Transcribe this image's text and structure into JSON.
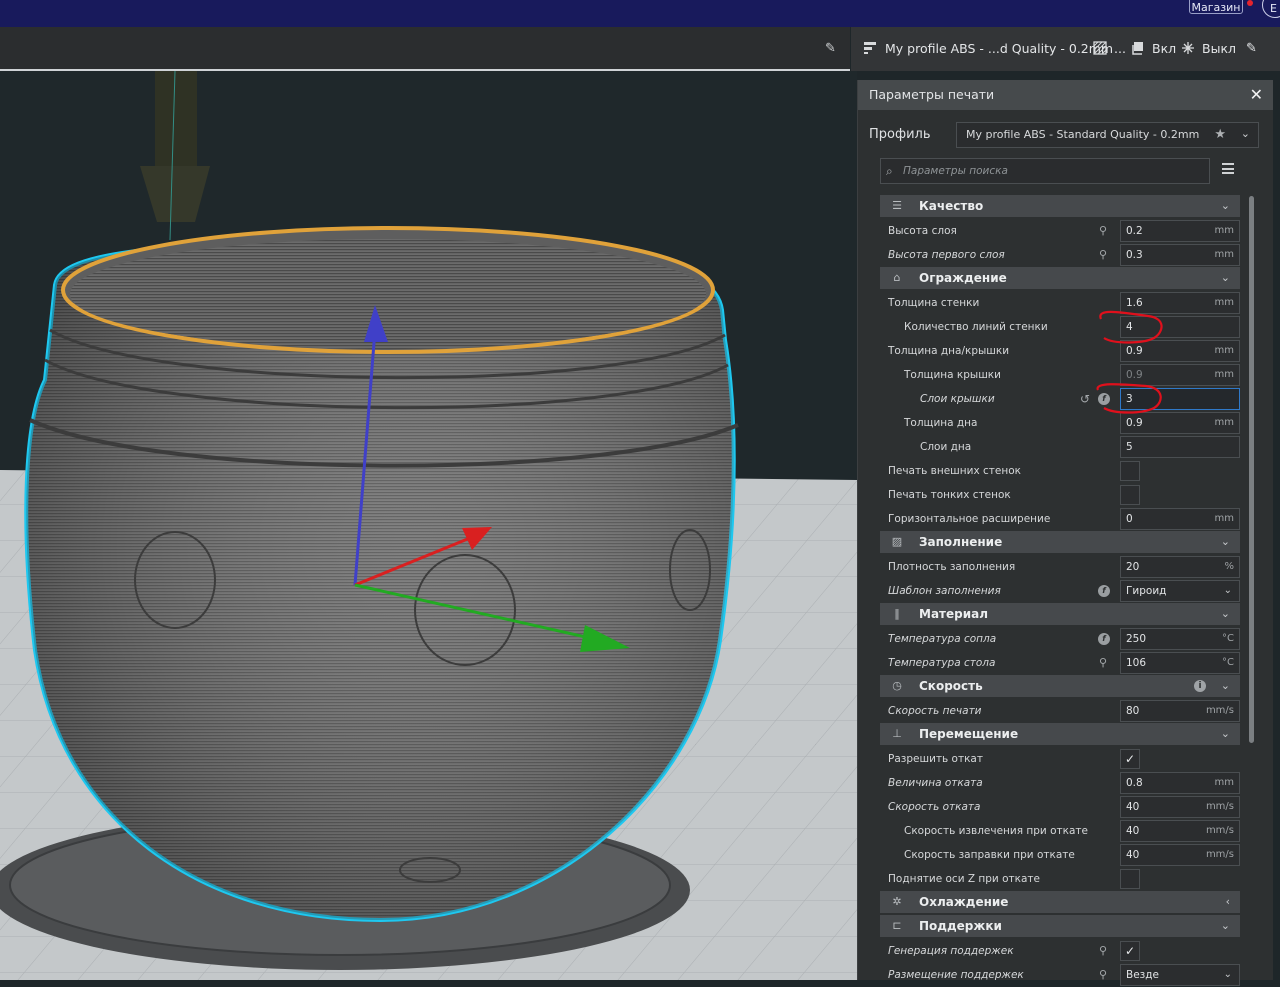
{
  "topbar": {
    "shop_label": "Магазин",
    "corner_label": "E"
  },
  "profile_bar": {
    "profile_label": "My profile ABS - ...d Quality - 0.2mm",
    "infill_value": "...",
    "support_label": "Вкл",
    "adhesion_label": "Выкл"
  },
  "panel": {
    "title": "Параметры печати",
    "profile_label": "Профиль",
    "profile_value": "My profile ABS - Standard Quality - 0.2mm",
    "search_placeholder": "Параметры поиска"
  },
  "sections": {
    "quality": "Качество",
    "walls": "Ограждение",
    "infill": "Заполнение",
    "material": "Материал",
    "speed": "Скорость",
    "travel": "Перемещение",
    "cooling": "Охлаждение",
    "support": "Поддержки"
  },
  "settings": {
    "layer_height": {
      "label": "Высота слоя",
      "value": "0.2",
      "unit": "mm"
    },
    "initial_layer_height": {
      "label": "Высота первого слоя",
      "value": "0.3",
      "unit": "mm"
    },
    "wall_thickness": {
      "label": "Толщина стенки",
      "value": "1.6",
      "unit": "mm"
    },
    "wall_line_count": {
      "label": "Количество линий стенки",
      "value": "4"
    },
    "top_bottom_thickness": {
      "label": "Толщина дна/крышки",
      "value": "0.9",
      "unit": "mm"
    },
    "top_thickness": {
      "label": "Толщина крышки",
      "value": "0.9",
      "unit": "mm"
    },
    "top_layers": {
      "label": "Слои крышки",
      "value": "3"
    },
    "bottom_thickness": {
      "label": "Толщина дна",
      "value": "0.9",
      "unit": "mm"
    },
    "bottom_layers": {
      "label": "Слои дна",
      "value": "5"
    },
    "outer_walls_first": {
      "label": "Печать внешних стенок"
    },
    "thin_walls": {
      "label": "Печать тонких стенок"
    },
    "horizontal_expansion": {
      "label": "Горизонтальное расширение",
      "value": "0",
      "unit": "mm"
    },
    "infill_density": {
      "label": "Плотность заполнения",
      "value": "20",
      "unit": "%"
    },
    "infill_pattern": {
      "label": "Шаблон заполнения",
      "value": "Гироид"
    },
    "nozzle_temp": {
      "label": "Температура сопла",
      "value": "250",
      "unit": "°C"
    },
    "bed_temp": {
      "label": "Температура стола",
      "value": "106",
      "unit": "°C"
    },
    "print_speed": {
      "label": "Скорость печати",
      "value": "80",
      "unit": "mm/s"
    },
    "retraction_enable": {
      "label": "Разрешить откат"
    },
    "retraction_distance": {
      "label": "Величина отката",
      "value": "0.8",
      "unit": "mm"
    },
    "retraction_speed": {
      "label": "Скорость отката",
      "value": "40",
      "unit": "mm/s"
    },
    "retraction_retract_speed": {
      "label": "Скорость извлечения при откате",
      "value": "40",
      "unit": "mm/s"
    },
    "retraction_prime_speed": {
      "label": "Скорость заправки при откате",
      "value": "40",
      "unit": "mm/s"
    },
    "z_hop": {
      "label": "Поднятие оси Z при откате"
    },
    "support_enable": {
      "label": "Генерация поддержек"
    },
    "support_placement": {
      "label": "Размещение поддержек",
      "value": "Везде"
    }
  },
  "icons": {
    "link": "link-icon",
    "reset": "reset-icon",
    "function": "function-icon",
    "check": "✓",
    "chevron_down": "⌄",
    "chevron_left": "‹"
  },
  "colors": {
    "topbar": "#181a5c",
    "panel": "#2d3031",
    "section": "#46494c",
    "model_outline": "#1ec8f0",
    "top_layer": "#e0a23a",
    "axis_x": "#d92020",
    "axis_y": "#22aa22",
    "axis_z": "#4040c8",
    "annotation": "#e0101c"
  }
}
